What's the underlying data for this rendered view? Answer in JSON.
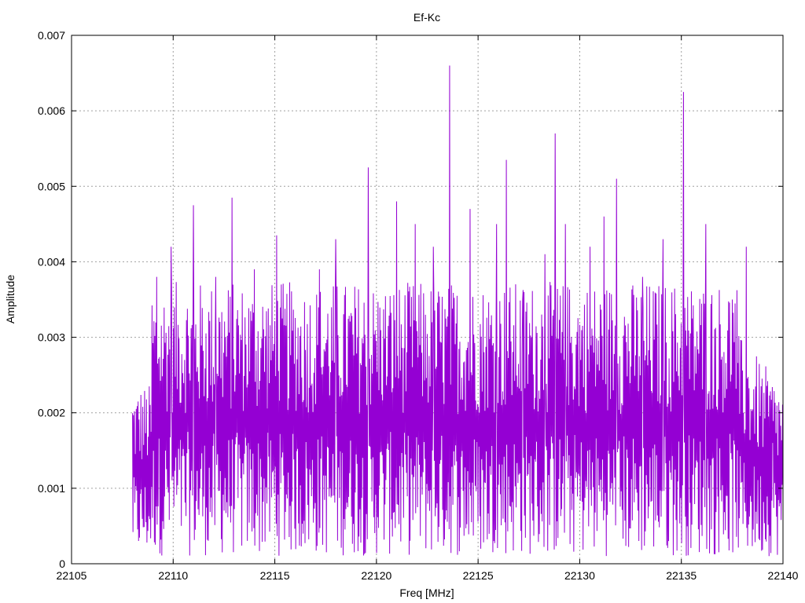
{
  "chart_data": {
    "type": "line",
    "title": "Ef-Kc",
    "xlabel": "Freq [MHz]",
    "ylabel": "Amplitude",
    "xlim": [
      22105,
      22140
    ],
    "ylim": [
      0,
      0.007
    ],
    "xticks": [
      "22105",
      "22110",
      "22115",
      "22120",
      "22125",
      "22130",
      "22135",
      "22140"
    ],
    "yticks": [
      "0",
      "0.001",
      "0.002",
      "0.003",
      "0.004",
      "0.005",
      "0.006",
      "0.007"
    ],
    "grid": true,
    "series": [
      {
        "color": "#9400d3",
        "x_start": 22108.0,
        "x_end": 22140.0,
        "peaks": [
          {
            "x": 22109.2,
            "y": 0.0038
          },
          {
            "x": 22109.9,
            "y": 0.0042
          },
          {
            "x": 22111.0,
            "y": 0.00475
          },
          {
            "x": 22112.1,
            "y": 0.0038
          },
          {
            "x": 22112.9,
            "y": 0.00485
          },
          {
            "x": 22114.0,
            "y": 0.0039
          },
          {
            "x": 22115.1,
            "y": 0.00435
          },
          {
            "x": 22117.2,
            "y": 0.0039
          },
          {
            "x": 22118.0,
            "y": 0.0043
          },
          {
            "x": 22119.6,
            "y": 0.00525
          },
          {
            "x": 22121.0,
            "y": 0.0048
          },
          {
            "x": 22121.9,
            "y": 0.0045
          },
          {
            "x": 22122.8,
            "y": 0.0042
          },
          {
            "x": 22123.6,
            "y": 0.0066
          },
          {
            "x": 22124.6,
            "y": 0.0047
          },
          {
            "x": 22125.9,
            "y": 0.0045
          },
          {
            "x": 22126.4,
            "y": 0.00535
          },
          {
            "x": 22127.2,
            "y": 0.0035
          },
          {
            "x": 22128.3,
            "y": 0.0041
          },
          {
            "x": 22128.8,
            "y": 0.0057
          },
          {
            "x": 22129.3,
            "y": 0.0045
          },
          {
            "x": 22130.5,
            "y": 0.0042
          },
          {
            "x": 22131.2,
            "y": 0.0046
          },
          {
            "x": 22131.8,
            "y": 0.0051
          },
          {
            "x": 22133.1,
            "y": 0.0038
          },
          {
            "x": 22134.1,
            "y": 0.0043
          },
          {
            "x": 22135.1,
            "y": 0.00625
          },
          {
            "x": 22136.2,
            "y": 0.0045
          },
          {
            "x": 22137.5,
            "y": 0.0035
          },
          {
            "x": 22138.2,
            "y": 0.0042
          },
          {
            "x": 22139.5,
            "y": 0.0016
          }
        ],
        "min": 0.0001,
        "n_points": 1400
      }
    ]
  }
}
